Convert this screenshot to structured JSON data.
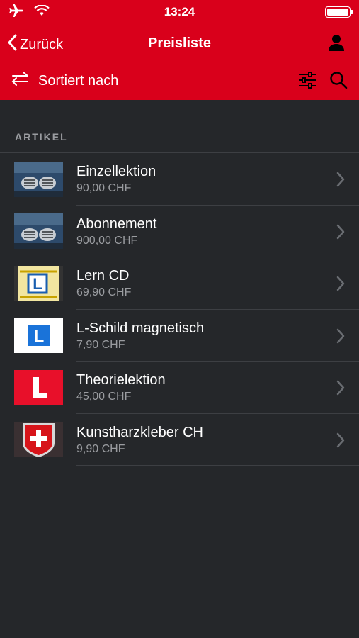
{
  "status": {
    "time": "13:24"
  },
  "nav": {
    "back_label": "Zurück",
    "title": "Preisliste"
  },
  "toolbar": {
    "sort_label": "Sortiert nach"
  },
  "section": {
    "header": "ARTIKEL"
  },
  "items": [
    {
      "name": "Einzellektion",
      "price": "90,00 CHF",
      "icon": "car-grille-image"
    },
    {
      "name": "Abonnement",
      "price": "900,00 CHF",
      "icon": "car-grille-image"
    },
    {
      "name": "Lern CD",
      "price": "69,90 CHF",
      "icon": "learner-cd-image"
    },
    {
      "name": "L-Schild magnetisch",
      "price": "7,90 CHF",
      "icon": "learner-sign-blue-image"
    },
    {
      "name": "Theorielektion",
      "price": "45,00 CHF",
      "icon": "learner-sign-red-image"
    },
    {
      "name": "Kunstharzkleber CH",
      "price": "9,90 CHF",
      "icon": "swiss-shield-image"
    }
  ],
  "colors": {
    "accent": "#d9001b",
    "background": "#25272a",
    "secondary_text": "#9a9ca0",
    "separator": "#3d3f43"
  }
}
